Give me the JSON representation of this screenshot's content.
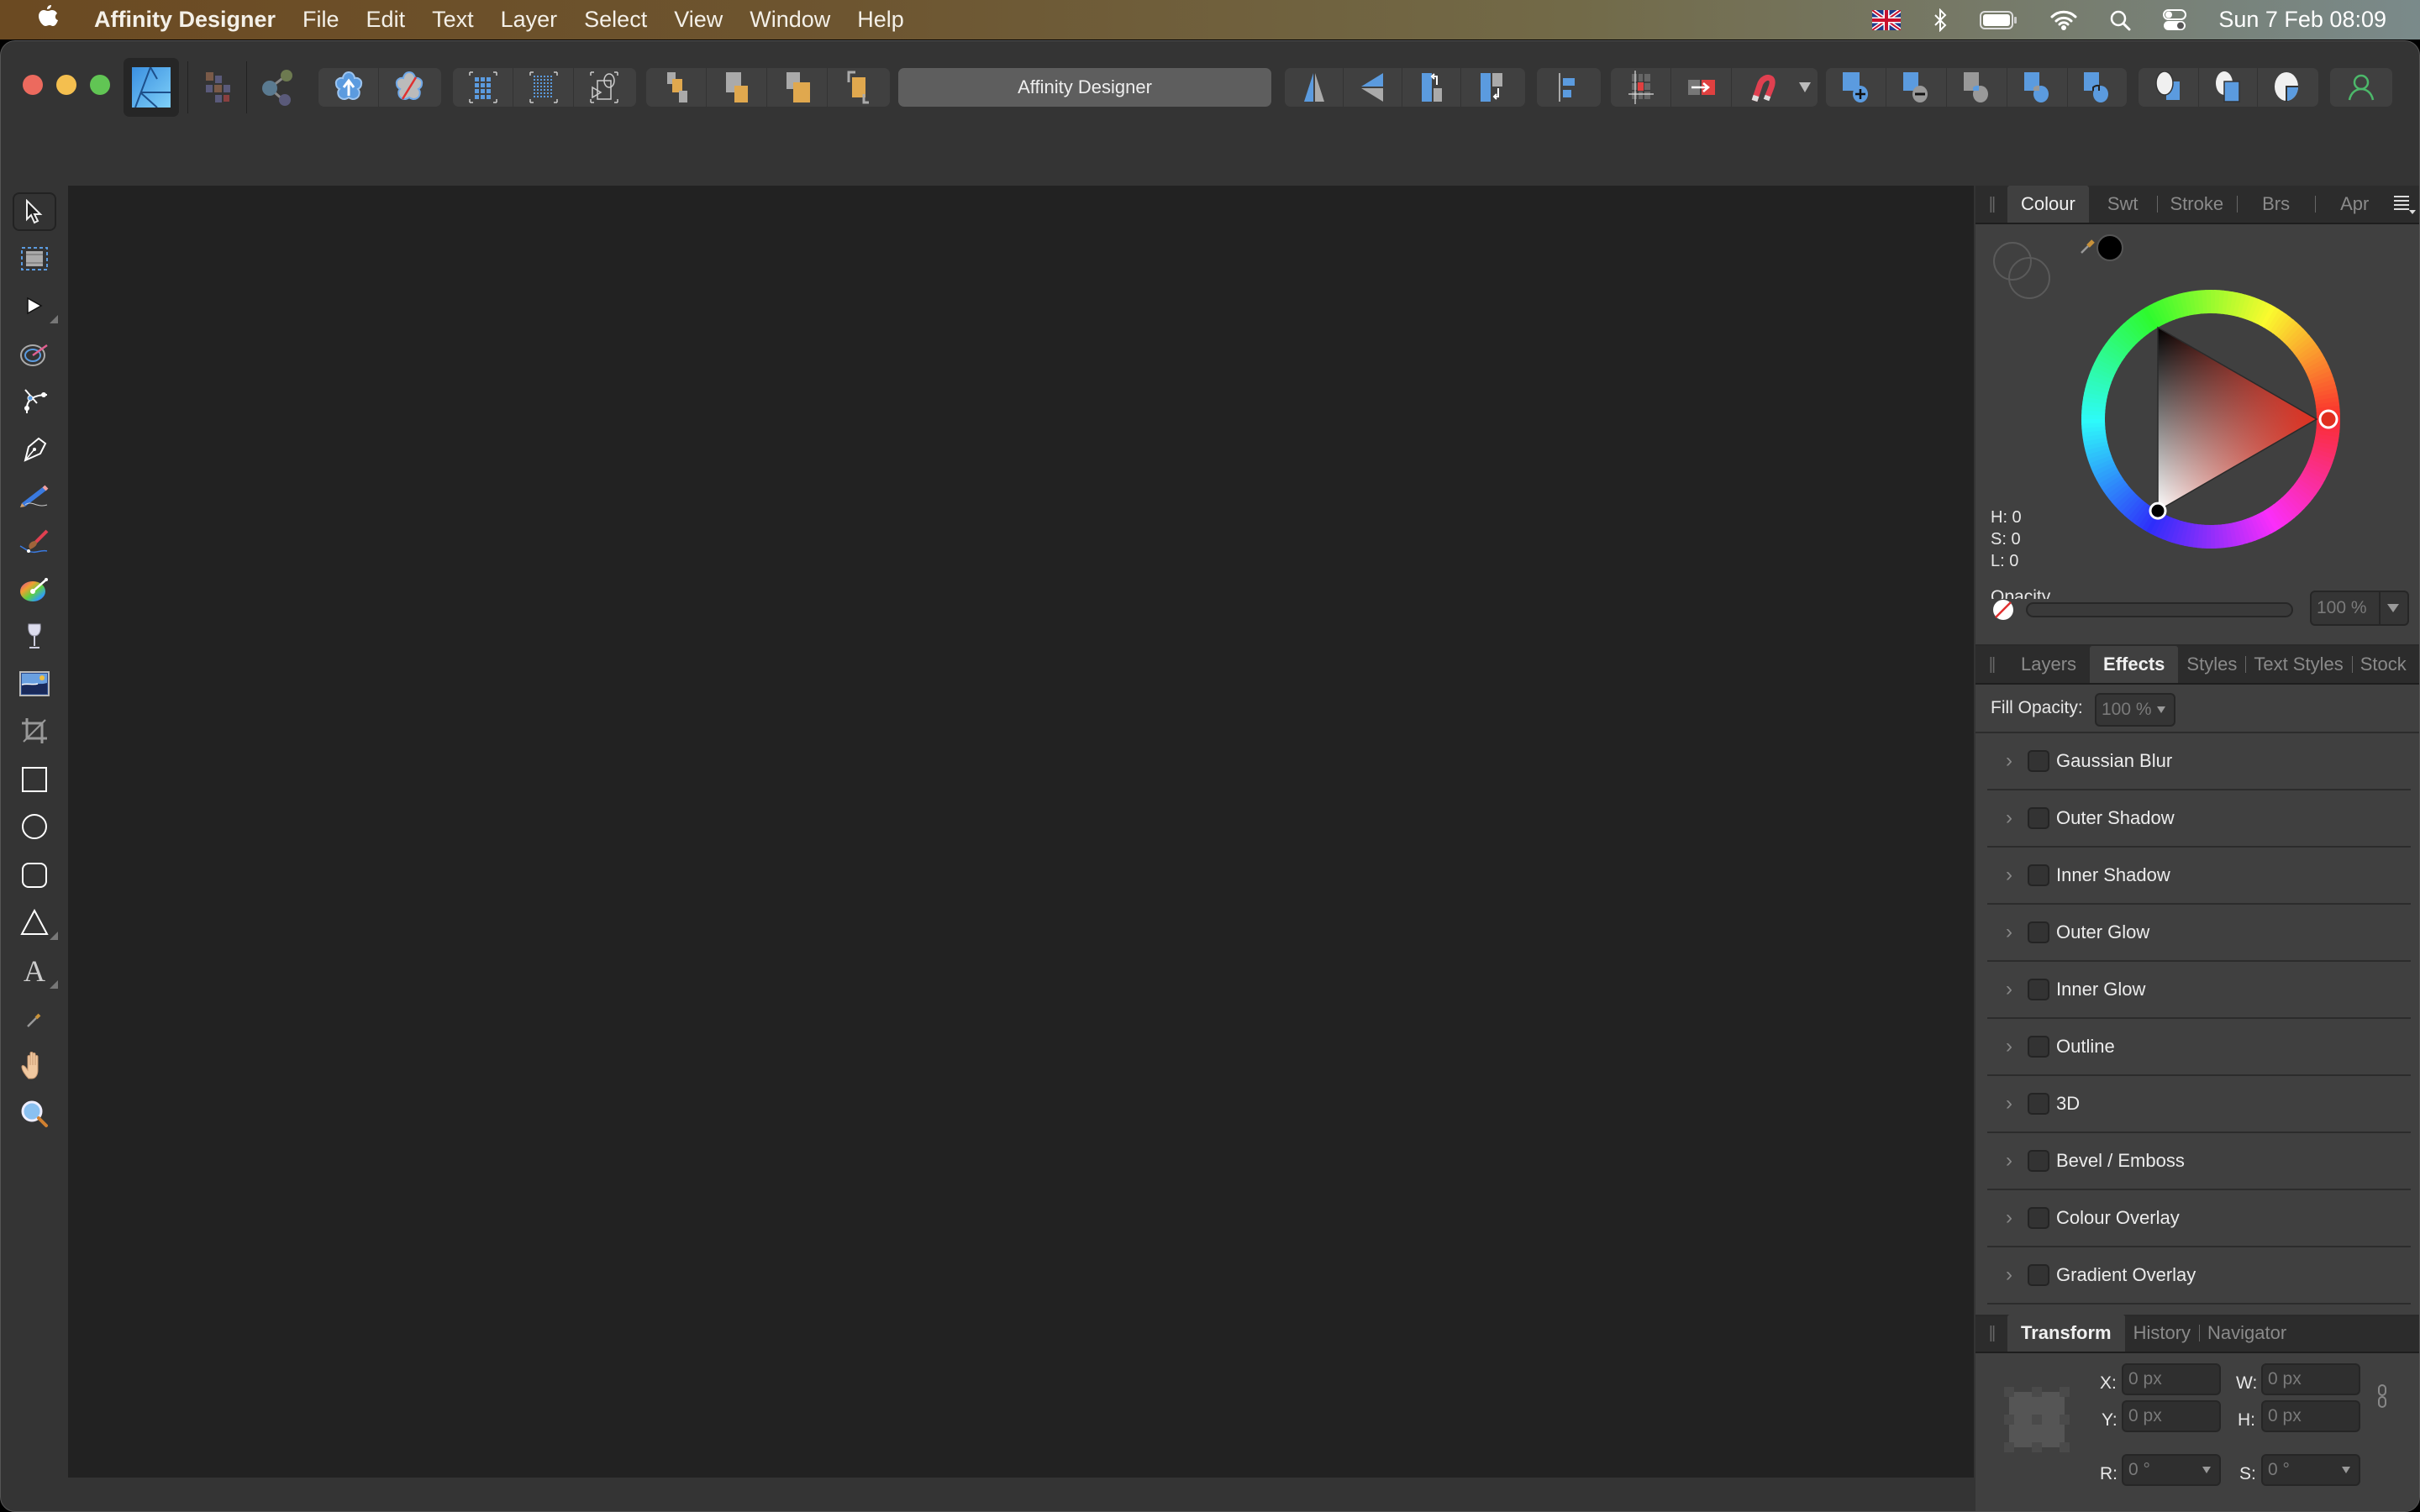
{
  "menubar": {
    "app_name": "Affinity Designer",
    "items": [
      "File",
      "Edit",
      "Text",
      "Layer",
      "Select",
      "View",
      "Window",
      "Help"
    ],
    "clock": "Sun 7 Feb  08:09",
    "status_icons": [
      "uk-flag-icon",
      "bluetooth-icon",
      "battery-icon",
      "wifi-icon",
      "spotlight-search-icon",
      "control-centre-icon"
    ]
  },
  "toolbar": {
    "document_title": "Affinity Designer",
    "persona_buttons": [
      "designer-persona",
      "pixel-persona",
      "export-persona"
    ],
    "groups": [
      [
        "add-assistant",
        "remove-assistant"
      ],
      [
        "snap-grid",
        "snap-pixel",
        "snap-geometry"
      ],
      [
        "move-back-one",
        "move-to-back",
        "move-to-front",
        "move-forward-one"
      ],
      [
        "flip-horizontal",
        "flip-vertical",
        "rotate-left",
        "rotate-right"
      ],
      [
        "align"
      ],
      [
        "snapping-grid",
        "snapping-force",
        "snapping-magnet",
        "snapping-options"
      ],
      [
        "boolean-add",
        "boolean-subtract",
        "boolean-intersect",
        "boolean-xor",
        "boolean-divide"
      ],
      [
        "insert-behind",
        "insert-inside",
        "insert-top"
      ],
      [
        "user-account"
      ]
    ]
  },
  "tools": [
    "move",
    "artboard",
    "node",
    "corner",
    "pen-point",
    "pen",
    "pencil",
    "vector-brush",
    "fill",
    "transparency",
    "place-image",
    "crop",
    "rectangle",
    "ellipse",
    "rounded-rectangle",
    "triangle",
    "artistic-text",
    "colour-picker",
    "view",
    "zoom"
  ],
  "colour_panel": {
    "tabs": [
      "Colour",
      "Swt",
      "Stroke",
      "Brs",
      "Apr"
    ],
    "active_tab": "Colour",
    "hsl": {
      "h": "H: 0",
      "s": "S: 0",
      "l": "L: 0"
    },
    "opacity_label": "Opacity",
    "opacity_value": "100 %",
    "current_colour": "#000000",
    "hue_degrees": 0
  },
  "effects_panel": {
    "tabs": [
      "Layers",
      "Effects",
      "Styles",
      "Text Styles",
      "Stock"
    ],
    "active_tab": "Effects",
    "fill_opacity_label": "Fill Opacity:",
    "fill_opacity_value": "100 %",
    "effects": [
      {
        "name": "Gaussian Blur",
        "enabled": false
      },
      {
        "name": "Outer Shadow",
        "enabled": false
      },
      {
        "name": "Inner Shadow",
        "enabled": false
      },
      {
        "name": "Outer Glow",
        "enabled": false
      },
      {
        "name": "Inner Glow",
        "enabled": false
      },
      {
        "name": "Outline",
        "enabled": false
      },
      {
        "name": "3D",
        "enabled": false
      },
      {
        "name": "Bevel / Emboss",
        "enabled": false
      },
      {
        "name": "Colour Overlay",
        "enabled": false
      },
      {
        "name": "Gradient Overlay",
        "enabled": false
      }
    ]
  },
  "transform_panel": {
    "tabs": [
      "Transform",
      "History",
      "Navigator"
    ],
    "active_tab": "Transform",
    "x_label": "X:",
    "x_value": "0 px",
    "y_label": "Y:",
    "y_value": "0 px",
    "w_label": "W:",
    "w_value": "0 px",
    "h_label": "H:",
    "h_value": "0 px",
    "r_label": "R:",
    "r_value": "0 °",
    "s_label": "S:",
    "s_value": "0 °"
  },
  "colors": {
    "accent_blue": "#5b9bdf",
    "accent_orange": "#e0a84e",
    "canvas": "#222222",
    "panel": "#404040"
  }
}
